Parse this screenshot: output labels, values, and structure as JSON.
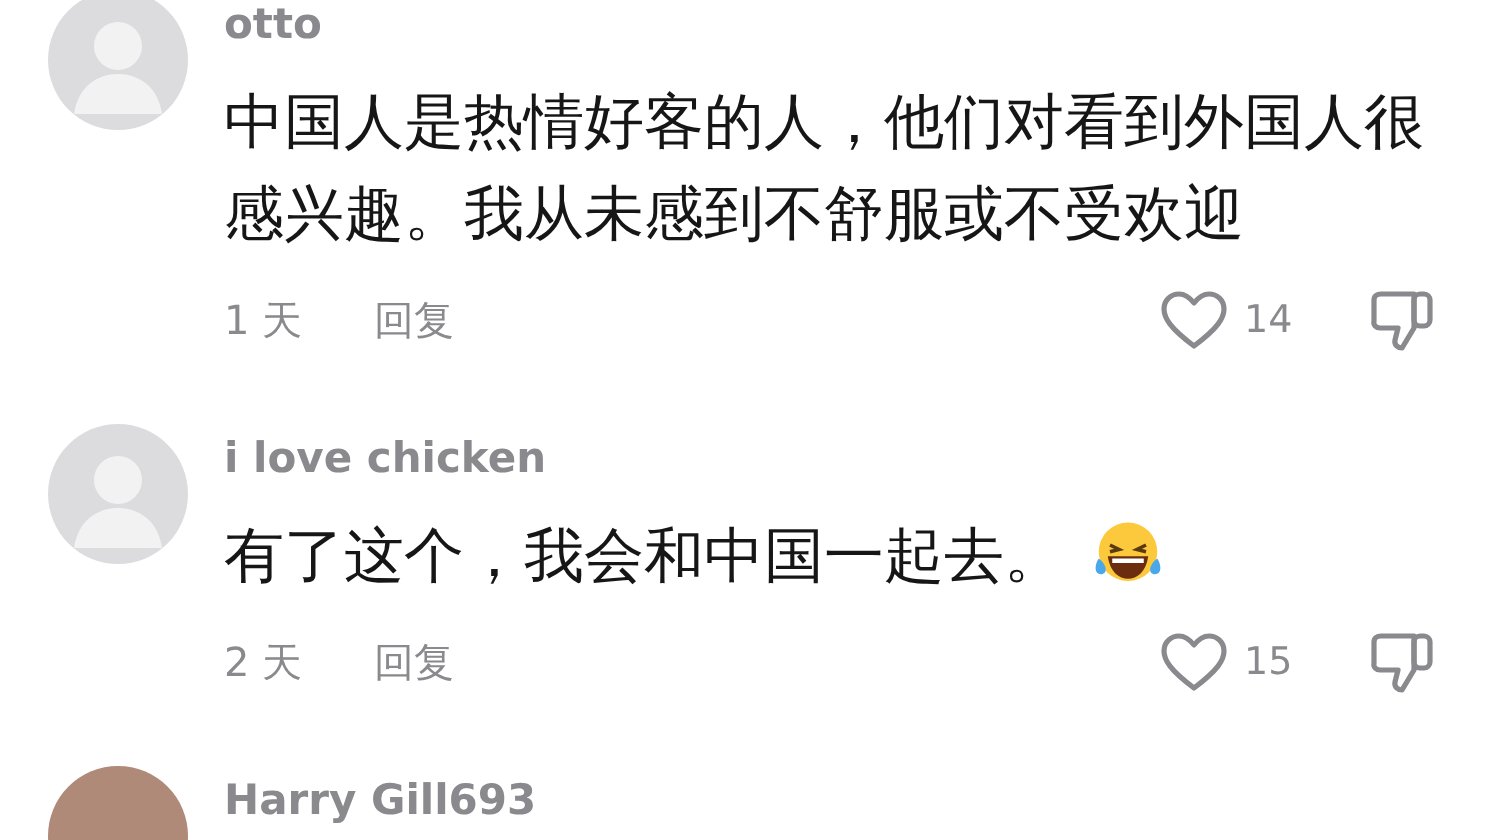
{
  "comments": [
    {
      "avatar": {
        "kind": "default"
      },
      "username": "otto",
      "text": "中国人是热情好客的人，他们对看到外国人很感兴趣。我从未感到不舒服或不受欢迎",
      "time": "1 天",
      "reply": "回复",
      "liked": false,
      "likes": "14",
      "disliked": false
    },
    {
      "avatar": {
        "kind": "default"
      },
      "username": "i love chicken",
      "text": "有了这个，我会和中国一起去。",
      "emoji": {
        "kind": "laughing"
      },
      "time": "2 天",
      "reply": "回复",
      "liked": false,
      "likes": "15",
      "disliked": false
    },
    {
      "avatar": {
        "kind": "photo"
      },
      "username": "Harry Gill693"
    }
  ]
}
